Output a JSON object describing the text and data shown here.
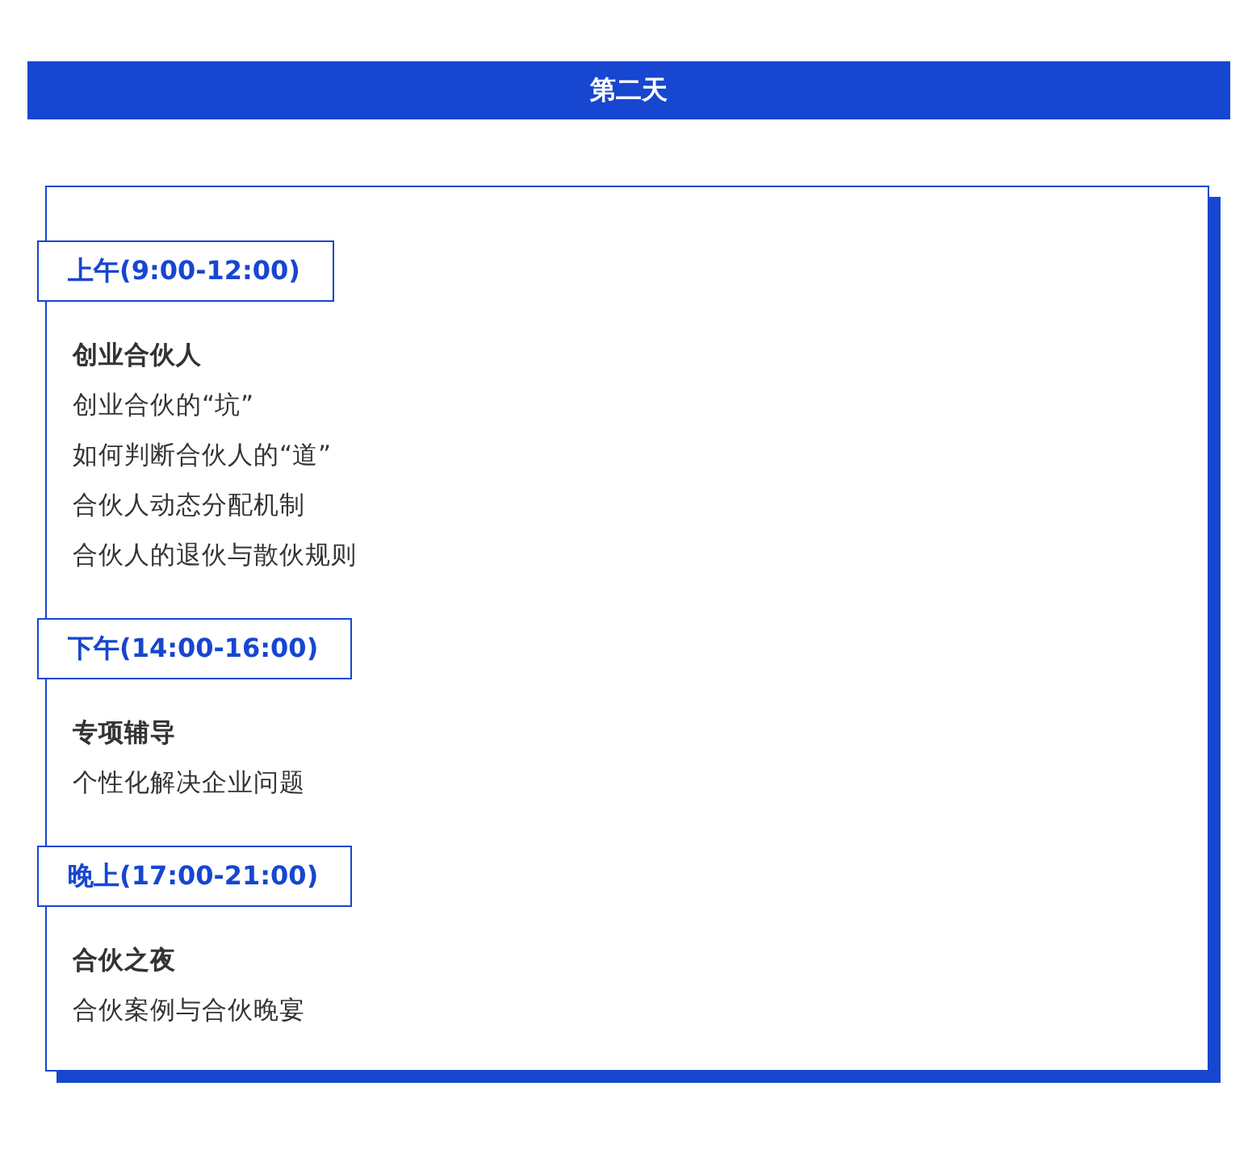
{
  "day_title": "第二天",
  "sessions": [
    {
      "time": "上午(9:00-12:00)",
      "topic": "创业合伙人",
      "items": [
        "创业合伙的“坑”",
        "如何判断合伙人的“道”",
        "合伙人动态分配机制",
        "合伙人的退伙与散伙规则"
      ]
    },
    {
      "time": "下午(14:00-16:00)",
      "topic": "专项辅导",
      "items": [
        "个性化解决企业问题"
      ]
    },
    {
      "time": "晚上(17:00-21:00)",
      "topic": "合伙之夜",
      "items": [
        "合伙案例与合伙晚宴"
      ]
    }
  ]
}
